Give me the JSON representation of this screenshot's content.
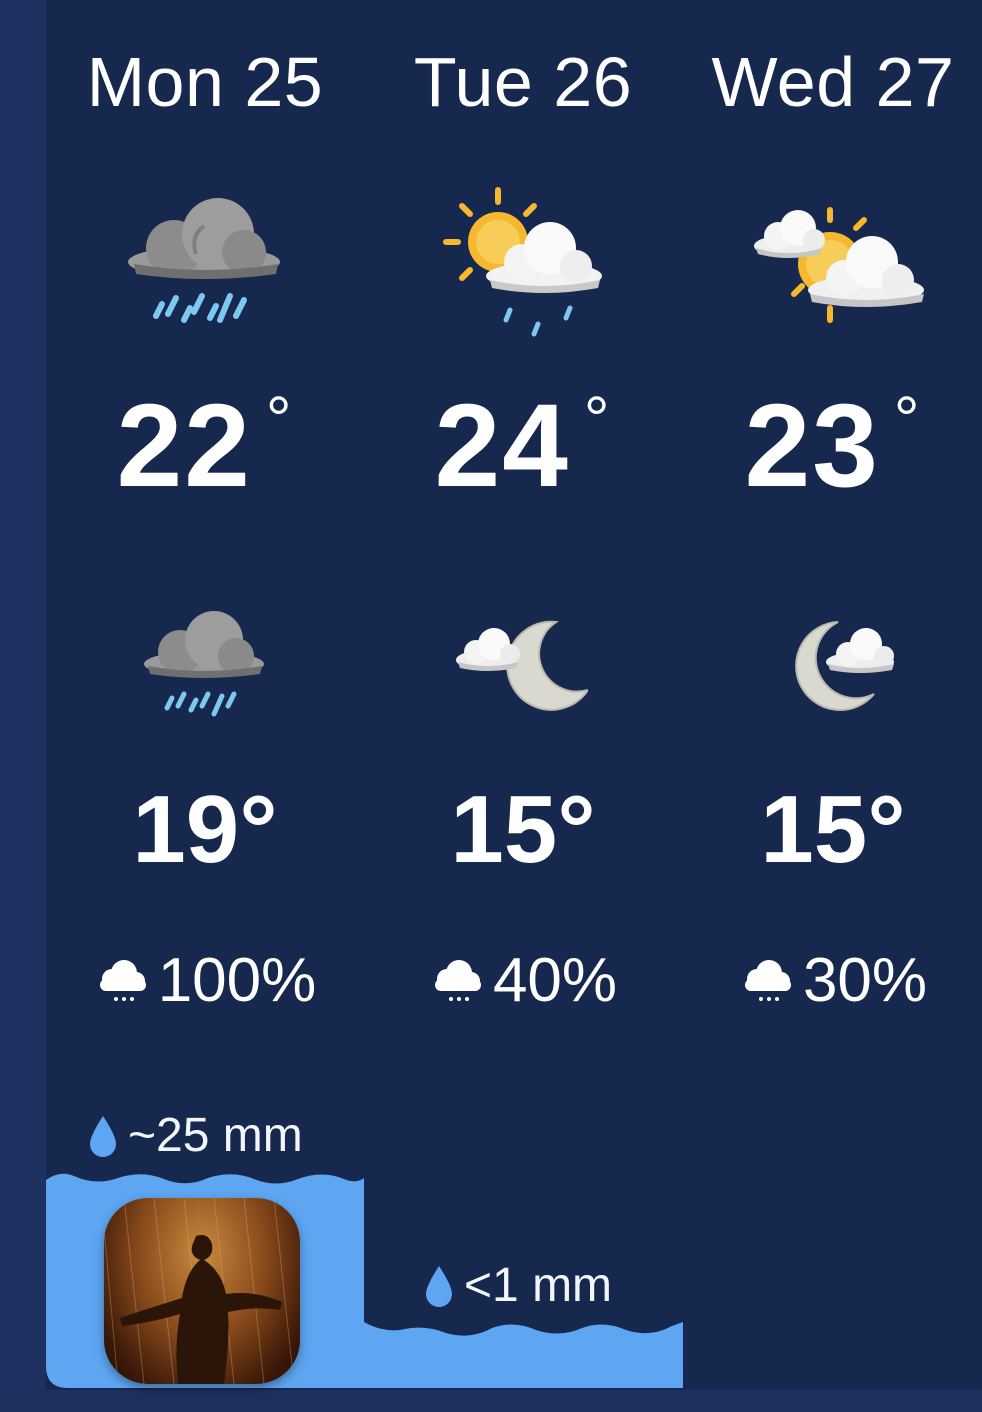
{
  "days": [
    {
      "label": "Mon 25",
      "day_icon": "rain-cloud-icon",
      "high": "22",
      "night_icon": "rain-cloud-icon",
      "low": "19°",
      "precip_chance": "100%",
      "amount": "~25 mm"
    },
    {
      "label": "Tue 26",
      "day_icon": "sun-cloud-light-rain-icon",
      "high": "24",
      "night_icon": "moon-cloud-icon",
      "low": "15°",
      "precip_chance": "40%",
      "amount": "<1 mm"
    },
    {
      "label": "Wed 27",
      "day_icon": "sun-behind-clouds-icon",
      "high": "23",
      "night_icon": "moon-cloud-icon",
      "low": "15°",
      "precip_chance": "30%",
      "amount": ""
    }
  ],
  "degree_symbol": "°",
  "colors": {
    "background": "#17284f",
    "water": "#5ea6f2",
    "rain": "#7dc8f0",
    "sun": "#f5b82e"
  }
}
